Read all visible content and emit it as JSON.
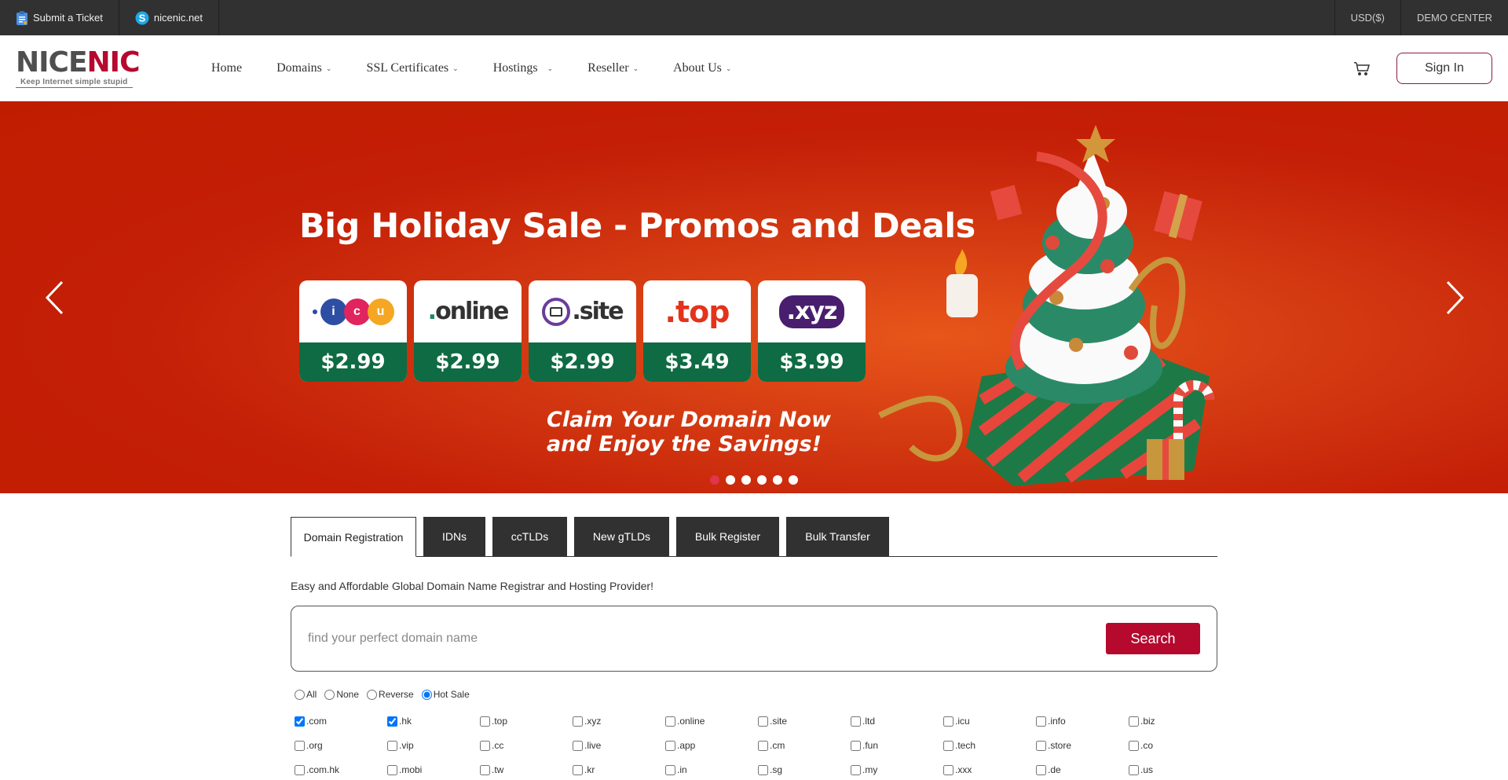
{
  "topbar": {
    "left": [
      {
        "label": "Submit a Ticket",
        "icon": "clipboard-icon"
      },
      {
        "label": "nicenic.net",
        "icon": "skype-icon"
      }
    ],
    "right": [
      {
        "label": "USD($)"
      },
      {
        "label": "DEMO CENTER"
      }
    ]
  },
  "header": {
    "logo": {
      "part1": "NICE",
      "part2": "NIC",
      "tagline": "Keep Internet simple stupid"
    },
    "nav": [
      {
        "label": "Home",
        "dropdown": false
      },
      {
        "label": "Domains",
        "dropdown": true
      },
      {
        "label": "SSL Certificates",
        "dropdown": true
      },
      {
        "label": "Hostings",
        "dropdown": true
      },
      {
        "label": "Reseller",
        "dropdown": true
      },
      {
        "label": "About Us",
        "dropdown": true
      }
    ],
    "signin_label": "Sign In"
  },
  "banner": {
    "headline": "Big Holiday Sale - Promos and Deals",
    "cards": [
      {
        "tld": ".icu",
        "price": "$2.99"
      },
      {
        "tld": ".online",
        "price": "$2.99"
      },
      {
        "tld": ".site",
        "price": "$2.99"
      },
      {
        "tld": ".top",
        "price": "$3.49"
      },
      {
        "tld": ".xyz",
        "price": "$3.99"
      }
    ],
    "claim_line1": "Claim Your Domain Now",
    "claim_line2": "and Enjoy the Savings!",
    "slide_count": 6,
    "active_slide": 1,
    "colors": {
      "background": "#c41f07",
      "price_band": "#0f6b43"
    }
  },
  "tabs": [
    {
      "label": "Domain Registration",
      "active": true
    },
    {
      "label": "IDNs",
      "active": false
    },
    {
      "label": "ccTLDs",
      "active": false
    },
    {
      "label": "New gTLDs",
      "active": false
    },
    {
      "label": "Bulk Register",
      "active": false
    },
    {
      "label": "Bulk Transfer",
      "active": false
    }
  ],
  "tagline": "Easy and Affordable Global Domain Name Registrar and Hosting Provider!",
  "search": {
    "placeholder": "find your perfect domain name",
    "value": "",
    "button_label": "Search",
    "accent": "#b5092e"
  },
  "selection_modes": [
    {
      "label": "All",
      "checked": false
    },
    {
      "label": "None",
      "checked": false
    },
    {
      "label": "Reverse",
      "checked": false
    },
    {
      "label": "Hot Sale",
      "checked": true
    }
  ],
  "tld_options": [
    {
      "label": ".com",
      "checked": true
    },
    {
      "label": ".hk",
      "checked": true
    },
    {
      "label": ".top",
      "checked": false
    },
    {
      "label": ".xyz",
      "checked": false
    },
    {
      "label": ".online",
      "checked": false
    },
    {
      "label": ".site",
      "checked": false
    },
    {
      "label": ".ltd",
      "checked": false
    },
    {
      "label": ".icu",
      "checked": false
    },
    {
      "label": ".info",
      "checked": false
    },
    {
      "label": ".biz",
      "checked": false
    },
    {
      "label": ".org",
      "checked": false
    },
    {
      "label": ".vip",
      "checked": false
    },
    {
      "label": ".cc",
      "checked": false
    },
    {
      "label": ".live",
      "checked": false
    },
    {
      "label": ".app",
      "checked": false
    },
    {
      "label": ".cm",
      "checked": false
    },
    {
      "label": ".fun",
      "checked": false
    },
    {
      "label": ".tech",
      "checked": false
    },
    {
      "label": ".store",
      "checked": false
    },
    {
      "label": ".co",
      "checked": false
    },
    {
      "label": ".com.hk",
      "checked": false
    },
    {
      "label": ".mobi",
      "checked": false
    },
    {
      "label": ".tw",
      "checked": false
    },
    {
      "label": ".kr",
      "checked": false
    },
    {
      "label": ".in",
      "checked": false
    },
    {
      "label": ".sg",
      "checked": false
    },
    {
      "label": ".my",
      "checked": false
    },
    {
      "label": ".xxx",
      "checked": false
    },
    {
      "label": ".de",
      "checked": false
    },
    {
      "label": ".us",
      "checked": false
    }
  ]
}
